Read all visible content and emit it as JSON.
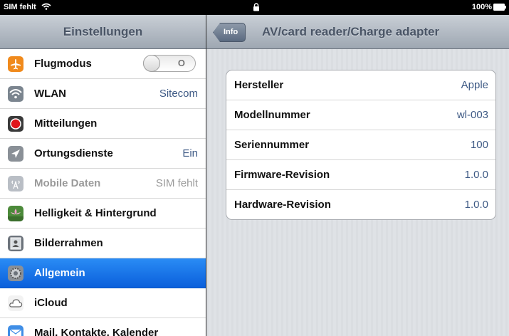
{
  "statusbar": {
    "carrier": "SIM fehlt",
    "battery": "100%"
  },
  "left": {
    "title": "Einstellungen",
    "items": [
      {
        "label": "Flugmodus",
        "toggle": "O"
      },
      {
        "label": "WLAN",
        "value": "Sitecom"
      },
      {
        "label": "Mitteilungen"
      },
      {
        "label": "Ortungsdienste",
        "value": "Ein"
      },
      {
        "label": "Mobile Daten",
        "value": "SIM fehlt"
      },
      {
        "label": "Helligkeit & Hintergrund"
      },
      {
        "label": "Bilderrahmen"
      },
      {
        "label": "Allgemein"
      },
      {
        "label": "iCloud"
      },
      {
        "label": "Mail, Kontakte, Kalender"
      }
    ]
  },
  "right": {
    "back": "Info",
    "title": "AV/card reader/Charge adapter",
    "rows": [
      {
        "label": "Hersteller",
        "value": "Apple"
      },
      {
        "label": "Modellnummer",
        "value": "wl-003"
      },
      {
        "label": "Seriennummer",
        "value": "100"
      },
      {
        "label": "Firmware-Revision",
        "value": "1.0.0"
      },
      {
        "label": "Hardware-Revision",
        "value": "1.0.0"
      }
    ]
  },
  "colors": {
    "selected": "#0a5fdb",
    "value_text": "#3e5a85",
    "header": "#9ea7b2"
  }
}
